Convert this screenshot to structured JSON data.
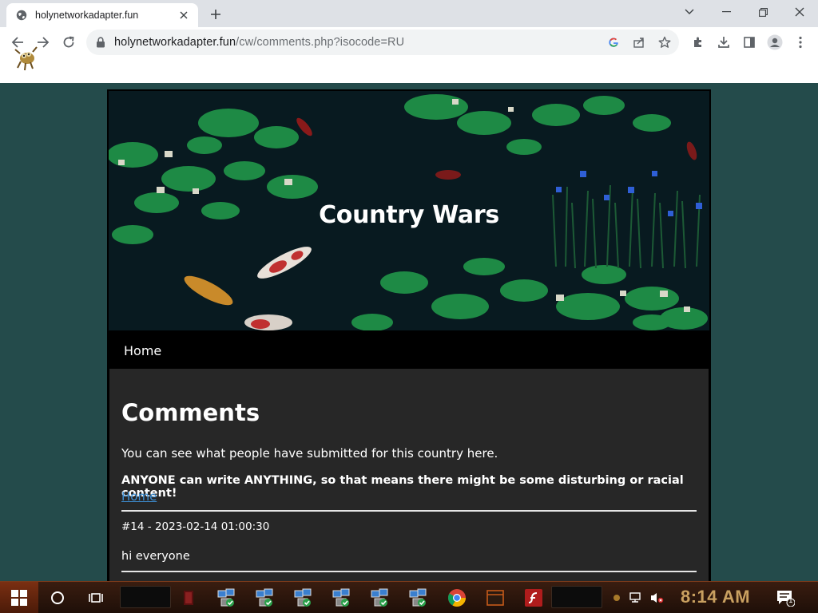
{
  "browser": {
    "tab_title": "holynetworkadapter.fun",
    "url_host": "holynetworkadapter.fun",
    "url_path": "/cw/comments.php?isocode=RU"
  },
  "site": {
    "title": "Country Wars",
    "nav_home": "Home"
  },
  "content": {
    "heading": "Comments",
    "intro": "You can see what people have submitted for this country here.",
    "warning": "ANYONE can write ANYTHING, so that means there might be some disturbing or racial content!",
    "home_link": "Home",
    "comments": [
      {
        "meta": "#14 - 2023-02-14 01:00:30",
        "text": "hi everyone"
      }
    ]
  },
  "taskbar": {
    "clock": "8:14 AM",
    "notification_count": "1"
  },
  "colors": {
    "page_background": "#244b4b",
    "content_background": "#272727",
    "link": "#3d8fd4",
    "clock": "#c9a060"
  }
}
